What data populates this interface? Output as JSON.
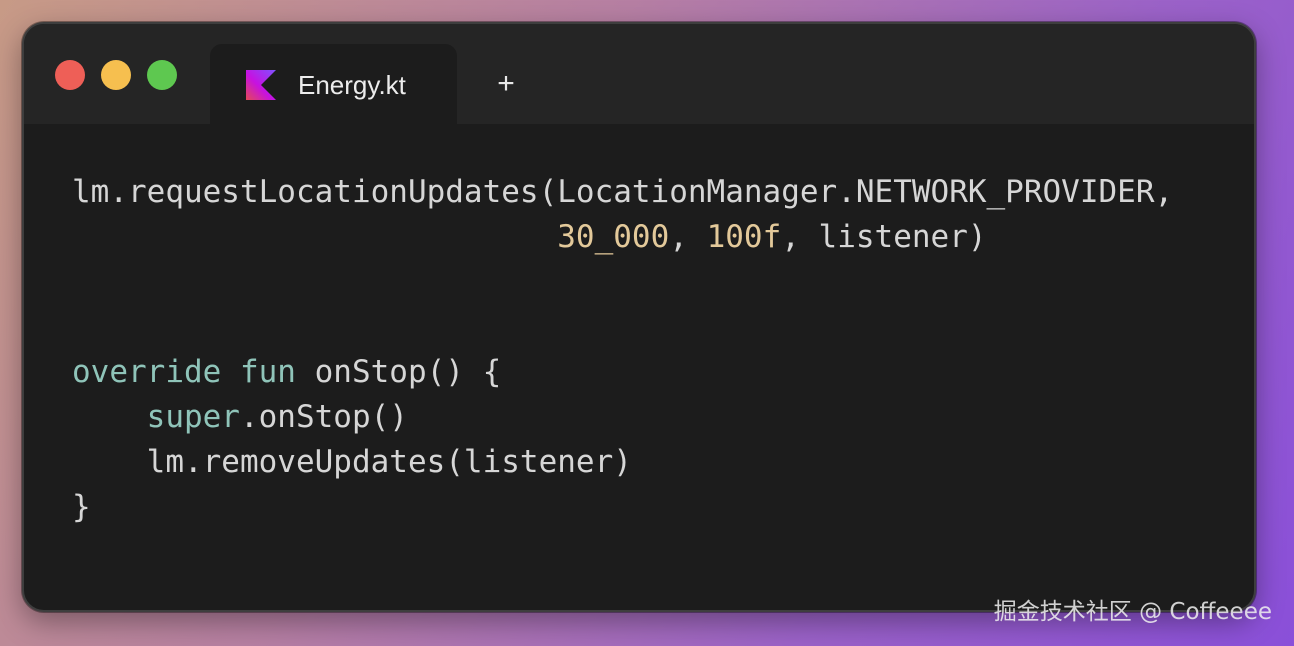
{
  "window": {
    "buttons": [
      {
        "name": "close",
        "color": "#ee5f57"
      },
      {
        "name": "minimize",
        "color": "#f6bf4f"
      },
      {
        "name": "zoom",
        "color": "#5ec850"
      }
    ]
  },
  "tab": {
    "icon": "kotlin-logo-icon",
    "title": "Energy.kt",
    "new_tab_label": "+"
  },
  "code": {
    "language": "kotlin",
    "lines": [
      [
        {
          "t": "lm.requestLocationUpdates(LocationManager.NETWORK_PROVIDER,",
          "k": "plain"
        }
      ],
      [
        {
          "t": "                          ",
          "k": "plain"
        },
        {
          "t": "30_000",
          "k": "num"
        },
        {
          "t": ", ",
          "k": "plain"
        },
        {
          "t": "100f",
          "k": "num"
        },
        {
          "t": ", listener)",
          "k": "plain"
        }
      ],
      [],
      [],
      [
        {
          "t": "override",
          "k": "kw"
        },
        {
          "t": " ",
          "k": "plain"
        },
        {
          "t": "fun",
          "k": "kw"
        },
        {
          "t": " onStop() {",
          "k": "plain"
        }
      ],
      [
        {
          "t": "    ",
          "k": "plain"
        },
        {
          "t": "super",
          "k": "kw"
        },
        {
          "t": ".onStop()",
          "k": "plain"
        }
      ],
      [
        {
          "t": "    lm.removeUpdates(listener)",
          "k": "plain"
        }
      ],
      [
        {
          "t": "}",
          "k": "plain"
        }
      ]
    ]
  },
  "colors": {
    "background": "#1c1c1c",
    "titlebar": "#252525",
    "text": "#d6d6d6",
    "number": "#e3c99a",
    "keyword": "#8fc4b9"
  },
  "watermark": "掘金技术社区 @ Coffeeee"
}
